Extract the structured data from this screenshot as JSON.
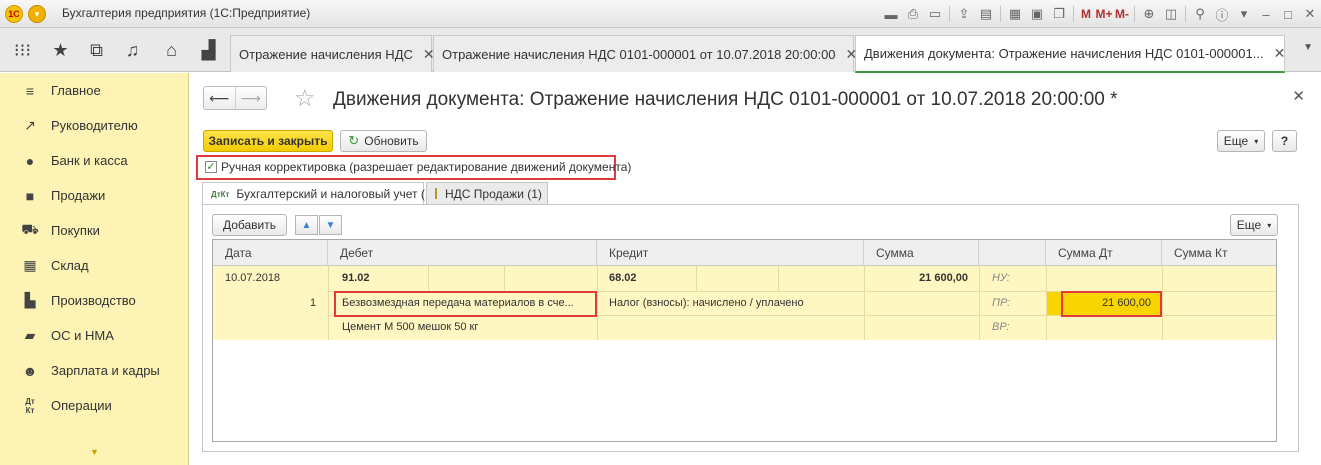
{
  "app": {
    "title": "Бухгалтерия предприятия (1С:Предприятие)",
    "logo_text": "1С",
    "toolbar_m": [
      "M",
      "M+",
      "M-"
    ]
  },
  "tabs": [
    {
      "label": "Отражение начисления НДС",
      "close": "✕"
    },
    {
      "label": "Отражение начисления НДС 0101-000001 от 10.07.2018 20:00:00",
      "close": "✕"
    },
    {
      "label": "Движения документа: Отражение начисления НДС 0101-000001...",
      "close": "✕"
    }
  ],
  "sidebar": {
    "items": [
      {
        "label": "Главное",
        "icon": "menu-icon"
      },
      {
        "label": "Руководителю",
        "icon": "chart-trend-icon"
      },
      {
        "label": "Банк и касса",
        "icon": "coin-icon"
      },
      {
        "label": "Продажи",
        "icon": "shopping-bag-icon"
      },
      {
        "label": "Покупки",
        "icon": "cart-icon"
      },
      {
        "label": "Склад",
        "icon": "warehouse-icon"
      },
      {
        "label": "Производство",
        "icon": "factory-icon"
      },
      {
        "label": "ОС и НМА",
        "icon": "truck-icon"
      },
      {
        "label": "Зарплата и кадры",
        "icon": "person-icon"
      },
      {
        "label": "Операции",
        "icon": "dt-kt-icon"
      }
    ]
  },
  "form": {
    "title": "Движения документа: Отражение начисления НДС 0101-000001 от 10.07.2018 20:00:00 *",
    "save_close_label": "Записать и закрыть",
    "refresh_label": "Обновить",
    "more_label": "Еще",
    "help_label": "?",
    "manual_correction_label": "Ручная корректировка (разрешает редактирование движений документа)",
    "manual_correction_checked": true
  },
  "subtabs": [
    {
      "label": "Бухгалтерский и налоговый учет (1)",
      "icon_text": "ДтКт"
    },
    {
      "label": "НДС Продажи (1)"
    }
  ],
  "panel": {
    "add_label": "Добавить",
    "more_label": "Еще"
  },
  "grid": {
    "headers": {
      "date": "Дата",
      "debit": "Дебет",
      "credit": "Кредит",
      "amount": "Сумма",
      "blank": "",
      "amount_dt": "Сумма Дт",
      "amount_kt": "Сумма Кт"
    },
    "row": {
      "date": "10.07.2018",
      "line_no": "1",
      "debit_account": "91.02",
      "debit_subconto1": "Безвозмездная передача материалов в сче...",
      "debit_subconto2": "Цемент М 500 мешок 50 кг",
      "credit_account": "68.02",
      "credit_subconto1": "Налог (взносы): начислено / уплачено",
      "amount": "21 600,00",
      "nu_label": "НУ:",
      "pr_label": "ПР:",
      "vr_label": "ВР:",
      "amount_dt_pr": "21 600,00"
    }
  },
  "colors": {
    "sidebar_bg": "#fcf3b4",
    "row_bg": "#fff7c2",
    "primary_button": "#f2cc00",
    "highlight_border": "#e03a3a",
    "active_tab_underline": "#3c9a40"
  }
}
